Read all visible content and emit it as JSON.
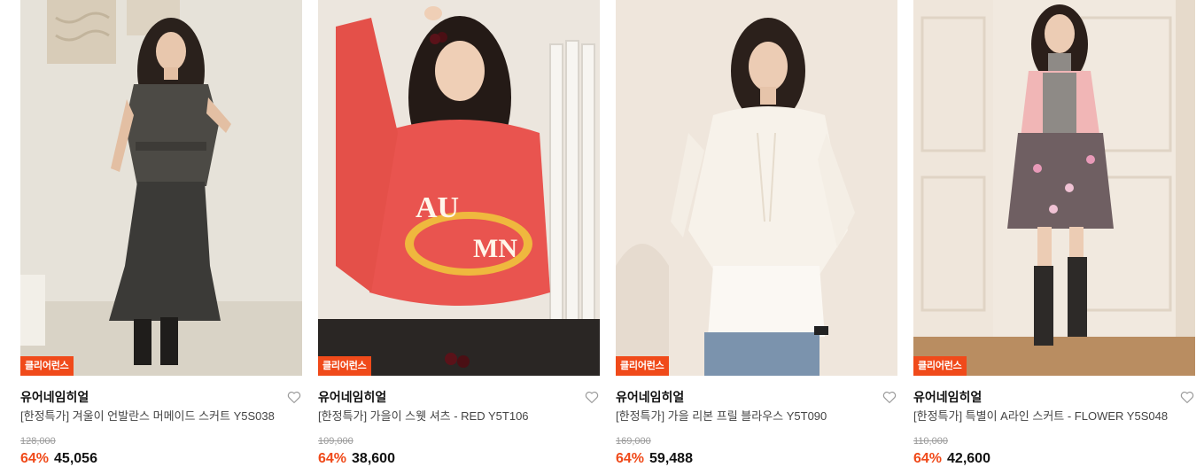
{
  "colors": {
    "accent": "#f04a1a",
    "brand_text": "#111111",
    "meta_text": "#444444",
    "strike_text": "#9a9a9a"
  },
  "products": [
    {
      "badge": "클리어런스",
      "brand": "유어네임히얼",
      "title": "[한정특가] 겨울이 언발란스 머메이드 스커트 Y5S038",
      "original_price": "128,000",
      "discount": "64%",
      "price": "45,056",
      "wishlist_icon": "heart-outline-icon"
    },
    {
      "badge": "클리어런스",
      "brand": "유어네임히얼",
      "title": "[한정특가] 가을이 스웻 셔츠 - RED Y5T106",
      "original_price": "109,000",
      "discount": "64%",
      "price": "38,600",
      "wishlist_icon": "heart-outline-icon"
    },
    {
      "badge": "클리어런스",
      "brand": "유어네임히얼",
      "title": "[한정특가] 가을 리본 프릴 블라우스 Y5T090",
      "original_price": "169,000",
      "discount": "64%",
      "price": "59,488",
      "wishlist_icon": "heart-outline-icon"
    },
    {
      "badge": "클리어런스",
      "brand": "유어네임히얼",
      "title": "[한정특가] 특별이 A라인 스커트 - FLOWER Y5S048",
      "original_price": "110,000",
      "discount": "64%",
      "price": "42,600",
      "wishlist_icon": "heart-outline-icon"
    }
  ]
}
